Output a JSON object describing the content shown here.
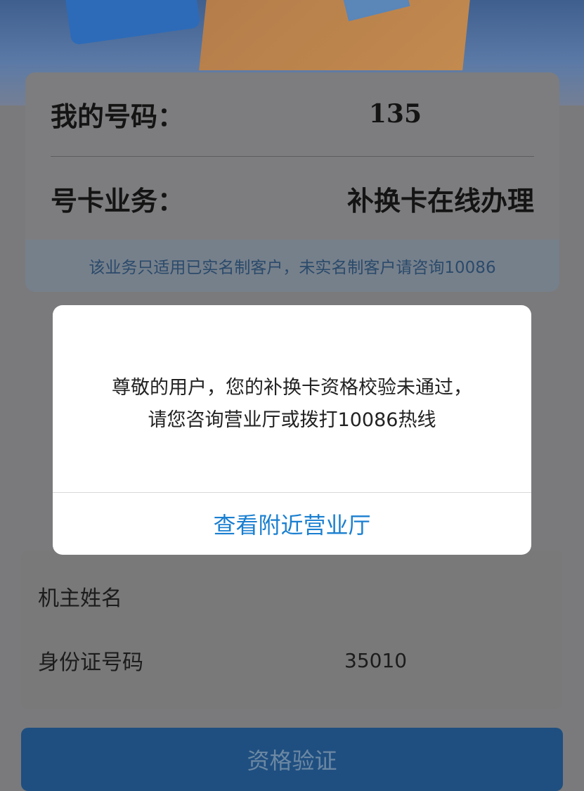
{
  "info": {
    "number_label": "我的号码：",
    "number_value": "135",
    "service_label": "号卡业务：",
    "service_value": "补换卡在线办理",
    "notice": "该业务只适用已实名制客户，未实名制客户请咨询10086"
  },
  "form": {
    "owner_label": "机主姓名",
    "owner_value": "",
    "id_label": "身份证号码",
    "id_value": "35010"
  },
  "submit_label": "资格验证",
  "dialog": {
    "message_line1": "尊敬的用户，您的补换卡资格校验未通过，",
    "message_line2": "请您咨询营业厅或拨打10086热线",
    "action_label": "查看附近营业厅"
  },
  "colors": {
    "accent": "#1a7fd0",
    "overlay": "#7a7a7c"
  }
}
